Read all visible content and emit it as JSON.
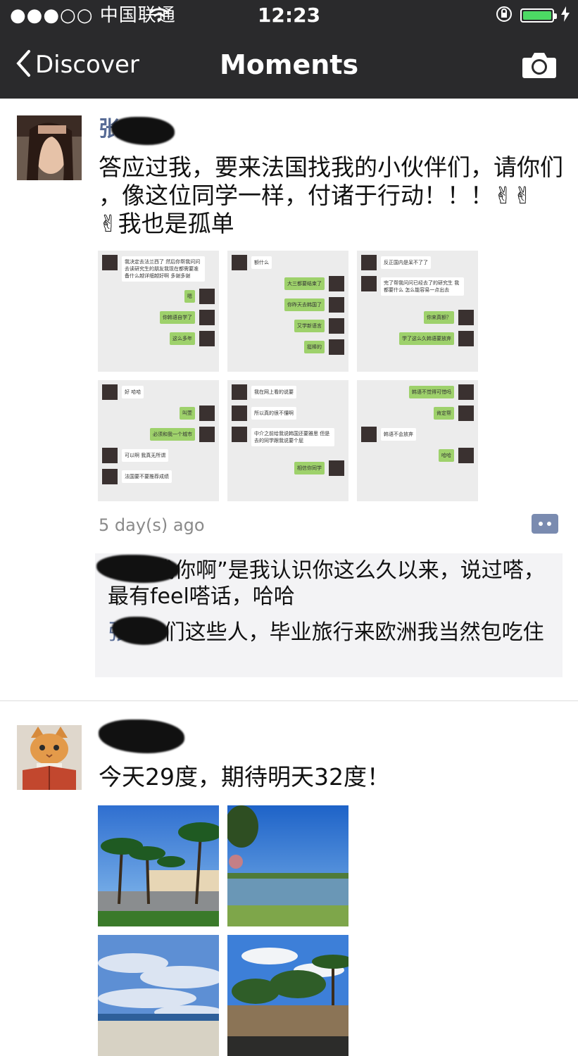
{
  "status_bar": {
    "carrier": "●●●○○ 中国联通",
    "time": "12:23",
    "battery_color": "#4cd964"
  },
  "nav": {
    "back_label": "Discover",
    "title": "Moments",
    "back_icon": "chevron-left-icon",
    "camera_icon": "camera-icon"
  },
  "posts": [
    {
      "name_visible": "张",
      "text": "答应过我，要来法国找我的小伙伴们，请你们\n，像这位同学一样，付诸于行动！！！✌✌\n✌我也是孤单",
      "time": "5 day(s) ago",
      "comments": [
        {
          "name": "",
          "text": ": “去找你啊”是我认识你这么久以来，说过嗒，最有feel嗒话，哈哈"
        },
        {
          "name": "张",
          "text": ": 你们这些人，毕业旅行来欧洲我当然包吃住"
        }
      ],
      "images": [
        {
          "msgs": [
            [
              "l",
              "我决定去法兰西了 然后你帮我问问去读研究生的朋友我现在都需要准备什么越详细越好啊 多谢多谢"
            ],
            [
              "r",
              "嗯"
            ],
            [
              "r",
              "你韩语自学了"
            ],
            [
              "r",
              "这么多年"
            ]
          ]
        },
        {
          "msgs": [
            [
              "l",
              "额什么"
            ],
            [
              "r",
              "大三都要结束了"
            ],
            [
              "r",
              "你昨天去韩国了"
            ],
            [
              "r",
              "又学新语言"
            ],
            [
              "r",
              "挺棒的"
            ]
          ]
        },
        {
          "msgs": [
            [
              "l",
              "反正国内是呆不了了"
            ],
            [
              "l",
              "完了帮我问问已经去了的研究生 我都要什么 怎么能容易一点出去"
            ],
            [
              "r",
              "你来真额？"
            ],
            [
              "r",
              "学了这么久韩语要放弃"
            ]
          ]
        },
        {
          "msgs": [
            [
              "l",
              "好 哈哈"
            ],
            [
              "r",
              "叫萱"
            ],
            [
              "r",
              "必须和我一个城市"
            ],
            [
              "l",
              "可以啊 我真无所谓"
            ],
            [
              "l",
              "法国要不要推荐成绩"
            ]
          ]
        },
        {
          "msgs": [
            [
              "l",
              "我在网上看的说要"
            ],
            [
              "l",
              "所以真的很不懂啊"
            ],
            [
              "l",
              "中介之前给我说韩国还要雅思 但是去的同学跟我说要个屁"
            ],
            [
              "r",
              "相信你同学"
            ]
          ]
        },
        {
          "msgs": [
            [
              "r",
              "韩语不觉得可惜吗"
            ],
            [
              "r",
              "肯定帮"
            ],
            [
              "l",
              "韩语不会放弃"
            ],
            [
              "r",
              "哈哈"
            ]
          ]
        }
      ]
    },
    {
      "name_visible": "",
      "text": "今天29度，期待明天32度！",
      "images": [
        {
          "scene": "palms-road"
        },
        {
          "scene": "lake"
        },
        {
          "scene": "sky-clouds"
        },
        {
          "scene": "palms-pool"
        }
      ]
    }
  ]
}
